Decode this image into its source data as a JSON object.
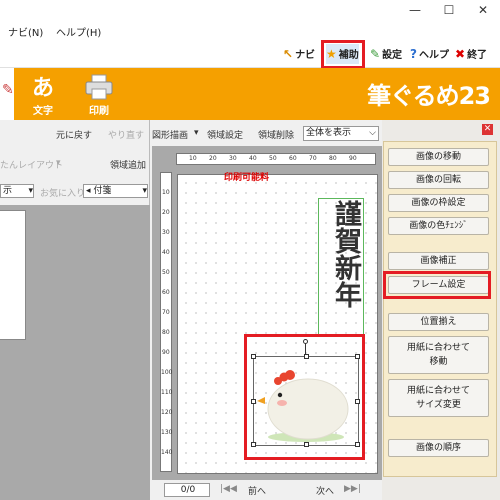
{
  "window": {
    "minimize": "—",
    "maximize": "☐",
    "close": "✕"
  },
  "menu": {
    "items": [
      "ナビ(N)",
      "ヘルプ(H)"
    ]
  },
  "quickbar": {
    "navi": {
      "label": "ナビ",
      "icon": "cursor-icon"
    },
    "hojo": {
      "label": "補助",
      "icon": "star-icon"
    },
    "settei": {
      "label": "設定",
      "icon": "wrench-icon"
    },
    "help": {
      "label": "ヘルプ",
      "icon": "question-icon"
    },
    "shuryo": {
      "label": "終了",
      "icon": "close-x-icon"
    }
  },
  "ribbon": {
    "text_button": "文字",
    "text_glyph": "あ",
    "print_button": "印刷",
    "logo": "筆ぐるめ23"
  },
  "left_panel": {
    "undo": "元に戻す",
    "redo": "やり直す",
    "layout": "たんレイアウト",
    "add_area": "領域追加",
    "display_select": "示",
    "favorites": "お気に入り",
    "attach_select": "付箋"
  },
  "center_toolbar": {
    "shape_draw": "図形描画",
    "area_setting": "領域設定",
    "area_delete": "領域削除",
    "zoom_value": "全体を表示"
  },
  "canvas": {
    "print_label": "印刷可能料",
    "greeting": "謹賀新年",
    "ruler_ticks": [
      "10",
      "20",
      "30",
      "40",
      "50",
      "60",
      "70",
      "80",
      "90"
    ],
    "vruler_ticks": [
      "10",
      "20",
      "30",
      "40",
      "50",
      "60",
      "70",
      "80",
      "90",
      "100",
      "110",
      "120",
      "130",
      "140"
    ]
  },
  "navigation": {
    "page": "0/0",
    "prev": "前へ",
    "next": "次へ"
  },
  "right_panel": {
    "buttons": [
      "画像の移動",
      "画像の回転",
      "画像の枠設定",
      "画像の色ﾁｪﾝｼﾞ",
      "画像補正",
      "フレーム設定",
      "位置揃え",
      "用紙に合わせて\n移動",
      "用紙に合わせて\nサイズ変更",
      "画像の順序"
    ]
  },
  "colors": {
    "ribbon": "#f5a000",
    "highlight": "#e41c23",
    "panel": "#f7eccd"
  }
}
